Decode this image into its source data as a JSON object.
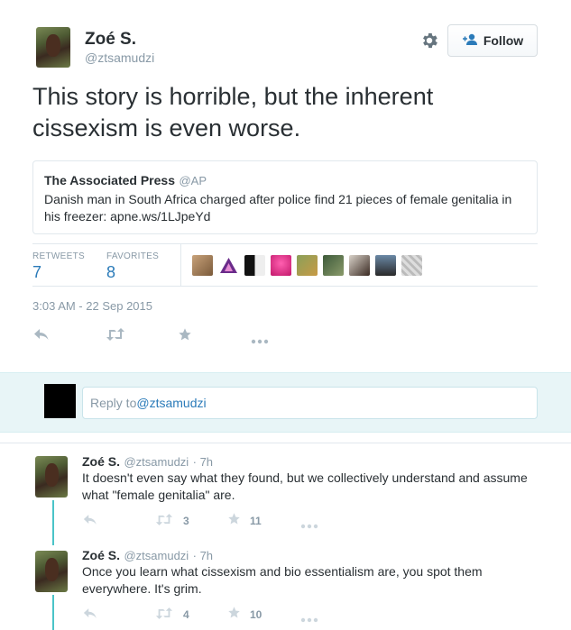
{
  "author": {
    "name": "Zoé S.",
    "handle": "@ztsamudzi"
  },
  "follow_label": "Follow",
  "tweet_text": "This story is horrible, but the inherent cissexism is even worse.",
  "quote": {
    "name": "The Associated Press",
    "handle": "@AP",
    "text": "Danish man in South Africa charged after police find 21 pieces of female genitalia in his freezer: apne.ws/1LJpeYd"
  },
  "stats": {
    "retweets_label": "RETWEETS",
    "retweets": "7",
    "favorites_label": "FAVORITES",
    "favorites": "8"
  },
  "timestamp": "3:03 AM - 22 Sep 2015",
  "reply_box": {
    "prefix": "Reply to ",
    "mention": "@ztsamudzi"
  },
  "replies": [
    {
      "name": "Zoé S.",
      "handle": "@ztsamudzi",
      "time": "· 7h",
      "text": "It doesn't even say what they found, but we collectively understand and assume what \"female genitalia\" are.",
      "retweets": "3",
      "favorites": "11"
    },
    {
      "name": "Zoé S.",
      "handle": "@ztsamudzi",
      "time": "· 7h",
      "text": "Once you learn what cissexism and bio essentialism are, you spot them everywhere. It's grim.",
      "retweets": "4",
      "favorites": "10"
    }
  ],
  "colors": {
    "link": "#2b7bb9",
    "thread": "#4ac4c8",
    "reply_bg": "#e8f5f7"
  },
  "icons": [
    "gear-icon",
    "follow-person-icon",
    "reply-icon",
    "retweet-icon",
    "favorite-star-icon",
    "more-icon"
  ]
}
